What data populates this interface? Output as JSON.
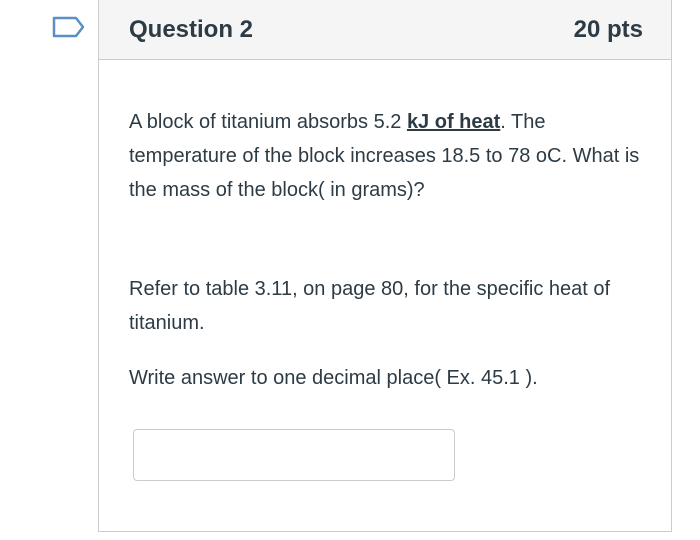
{
  "question": {
    "title": "Question 2",
    "points": "20 pts",
    "flag_icon": "bookmark-flag-icon",
    "paragraph1": {
      "text_before": "A block of titanium absorbs 5.2 ",
      "term": "kJ of heat",
      "text_after": ".  The temperature of the block increases 18.5 to 78 oC. What is the mass of the block( in grams)?"
    },
    "paragraph2": "Refer to table 3.11, on page 80, for the specific heat of titanium.",
    "paragraph3": "Write answer to one decimal place( Ex. 45.1 ).",
    "answer": {
      "value": "",
      "placeholder": ""
    }
  },
  "colors": {
    "flag_stroke": "#5b8fc7",
    "text": "#2d3b45",
    "border": "#c7cdd1",
    "header_bg": "#f5f5f5"
  }
}
